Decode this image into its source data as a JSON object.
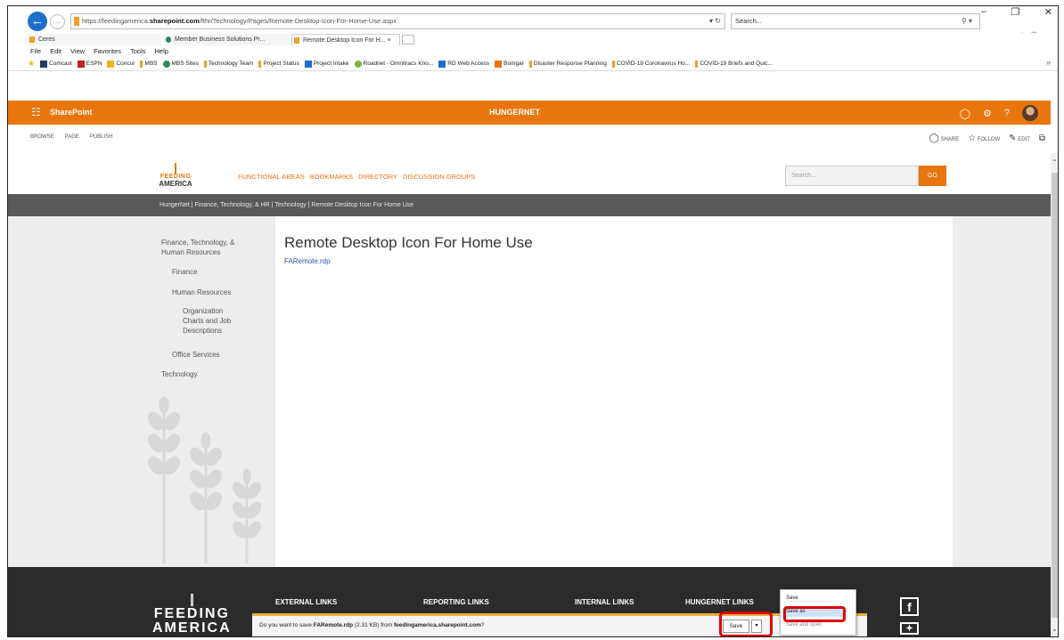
{
  "browser": {
    "url_prefix": "https://feedingamerica.",
    "url_domain": "sharepoint.com",
    "url_path": "/fthr/Technology/Pages/Remote-Desktop-Icon-For-Home-Use.aspx",
    "search_placeholder": "Search...",
    "tabs": [
      {
        "label": "Ceres"
      },
      {
        "label": "Member Business Solutions Pr..."
      },
      {
        "label": "Remote Desktop Icon For H... ×"
      }
    ],
    "menu": [
      "File",
      "Edit",
      "View",
      "Favorites",
      "Tools",
      "Help"
    ],
    "favorites": [
      {
        "label": "Comcast",
        "color": "#1f3b63"
      },
      {
        "label": "ESPN",
        "color": "#c41e1e"
      },
      {
        "label": "Concur",
        "color": "#f2b01e"
      },
      {
        "label": "MBS",
        "color": "#e8a22b"
      },
      {
        "label": "MBS Sites",
        "color": "#2f8a5b"
      },
      {
        "label": "Technology Team",
        "color": "#e8a22b"
      },
      {
        "label": "Project Status",
        "color": "#e8a22b"
      },
      {
        "label": "Project Intake",
        "color": "#1e6fc9"
      },
      {
        "label": "Roadnet - Omnitracs Kno...",
        "color": "#7bb442"
      },
      {
        "label": "RD Web Access",
        "color": "#1e6fc9"
      },
      {
        "label": "Bomgar",
        "color": "#e9750e"
      },
      {
        "label": "Disaster Response Planning",
        "color": "#e8a22b"
      },
      {
        "label": "COVID-19 Coronavirus Ho...",
        "color": "#e8a22b"
      },
      {
        "label": "COVID-19 Briefs and Quic...",
        "color": "#e8a22b"
      }
    ]
  },
  "suite": {
    "brand": "SharePoint",
    "site": "HUNGERNET"
  },
  "ribbon": {
    "tabs": [
      "BROWSE",
      "PAGE",
      "PUBLISH"
    ],
    "share": "SHARE",
    "follow": "FOLLOW",
    "edit": "EDIT"
  },
  "header": {
    "logo_line1": "FEEDING",
    "logo_line2": "AMERICA",
    "nav": [
      "FUNCTIONAL AREAS",
      "BOOKMARKS",
      "DIRECTORY",
      "DISCUSSION GROUPS"
    ],
    "search_placeholder": "Search...",
    "go_label": "GO"
  },
  "breadcrumb": "HungerNet | Finance, Technology, & HR | Technology | Remote Desktop Icon For Home Use",
  "left_nav": {
    "section_line1": "Finance, Technology, &",
    "section_line2": "Human Resources",
    "finance": "Finance",
    "hr": "Human Resources",
    "org_line1": "Organization",
    "org_line2": "Charts and Job",
    "org_line3": "Descriptions",
    "office": "Office Services",
    "tech": "Technology"
  },
  "content": {
    "title": "Remote Desktop Icon For Home Use",
    "file_link": "FARemote.rdp"
  },
  "footer": {
    "logo_line1": "FEEDING",
    "logo_line2": "AMERICA",
    "headings": [
      "EXTERNAL LINKS",
      "REPORTING LINKS",
      "INTERNAL LINKS",
      "HUNGERNET LINKS"
    ]
  },
  "download": {
    "prefix": "Do you want to save ",
    "file": "FARemote.rdp",
    "size": " (2.31 KB) from ",
    "source": "feedingamerica.sharepoint.com",
    "suffix": "?",
    "save_label": "Save",
    "menu": [
      "Save",
      "Save as",
      "Save and open"
    ]
  },
  "colors": {
    "accent": "#e9750e",
    "highlight": "#e00000"
  }
}
